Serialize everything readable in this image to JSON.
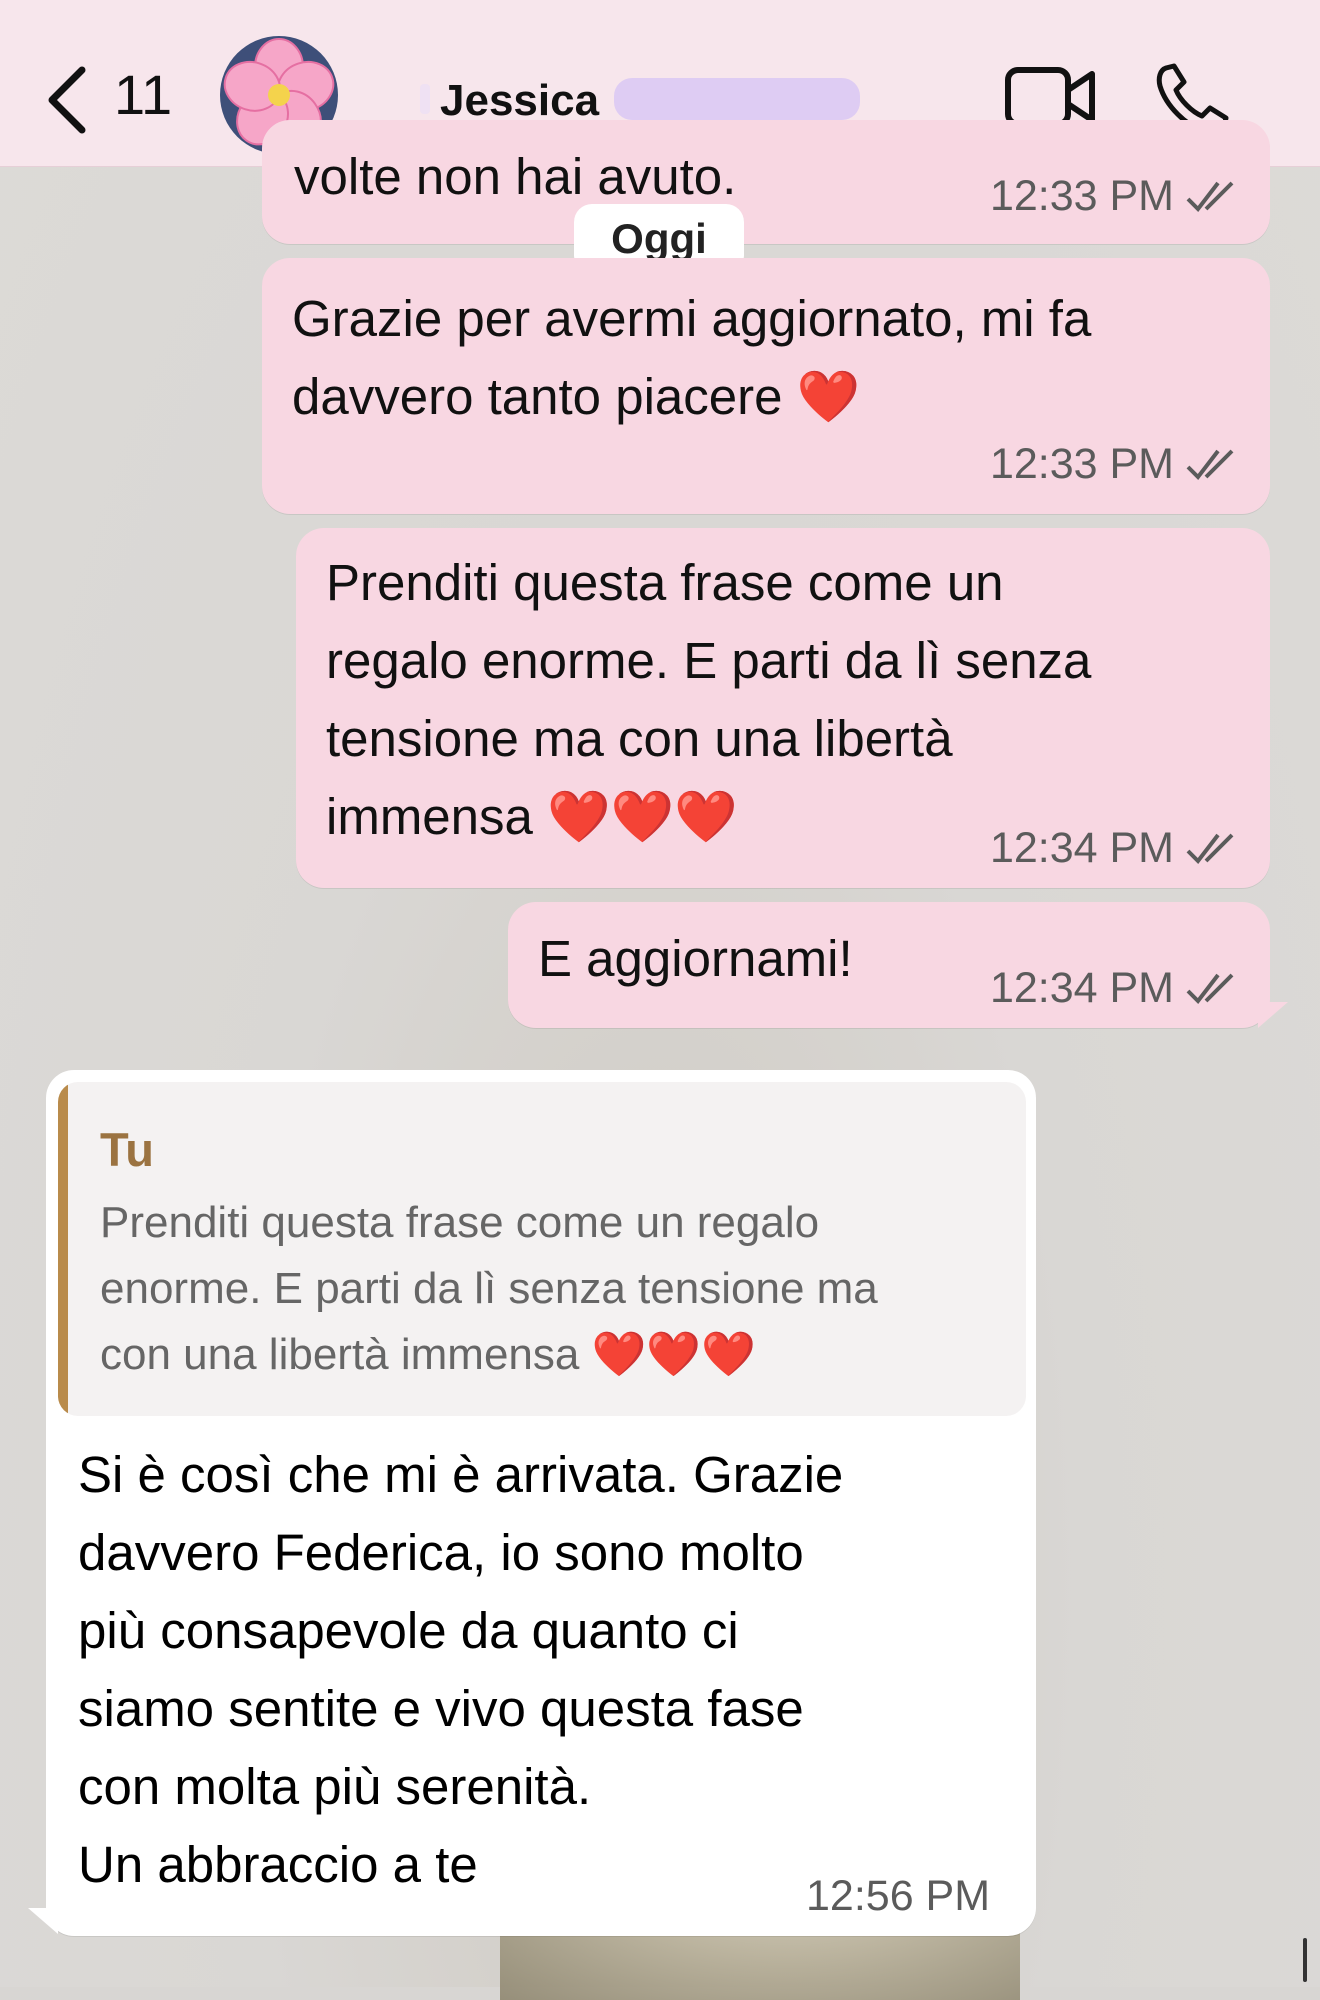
{
  "header": {
    "back_count": "11",
    "contact_name": "Jessica",
    "icons": [
      "chevron-left-icon",
      "video-call-icon",
      "phone-call-icon"
    ]
  },
  "date_divider": "Oggi",
  "messages": [
    {
      "text_lines": [
        "volte non hai avuto."
      ],
      "time": "12:33 PM"
    },
    {
      "text_lines": [
        "Grazie per avermi aggiornato, mi fa",
        "davvero tanto piacere ❤️"
      ],
      "time": "12:33 PM"
    },
    {
      "text_lines": [
        "Prenditi questa frase come un",
        "regalo enorme. E parti da lì senza",
        "tensione ma con una libertà",
        "immensa ❤️❤️❤️"
      ],
      "time": "12:34 PM"
    },
    {
      "text_lines": [
        "E aggiornami!"
      ],
      "time": "12:34 PM"
    }
  ],
  "reply": {
    "quote_author": "Tu",
    "quote_lines": [
      "Prenditi questa frase come un regalo",
      "enorme. E parti da lì senza tensione ma",
      "con una libertà immensa ❤️❤️❤️"
    ],
    "text_lines": [
      "Si è così che mi è arrivata. Grazie",
      "davvero Federica, io sono molto",
      "più consapevole da quanto ci",
      "siamo sentite e vivo questa fase",
      "con molta più serenità.",
      "Un abbraccio a te"
    ],
    "time": "12:56 PM"
  },
  "colors": {
    "header_bg": "#f7e6ec",
    "outgoing_bubble": "#f8d7e2",
    "incoming_bubble": "#ffffff",
    "quote_accent": "#b98b4b"
  }
}
